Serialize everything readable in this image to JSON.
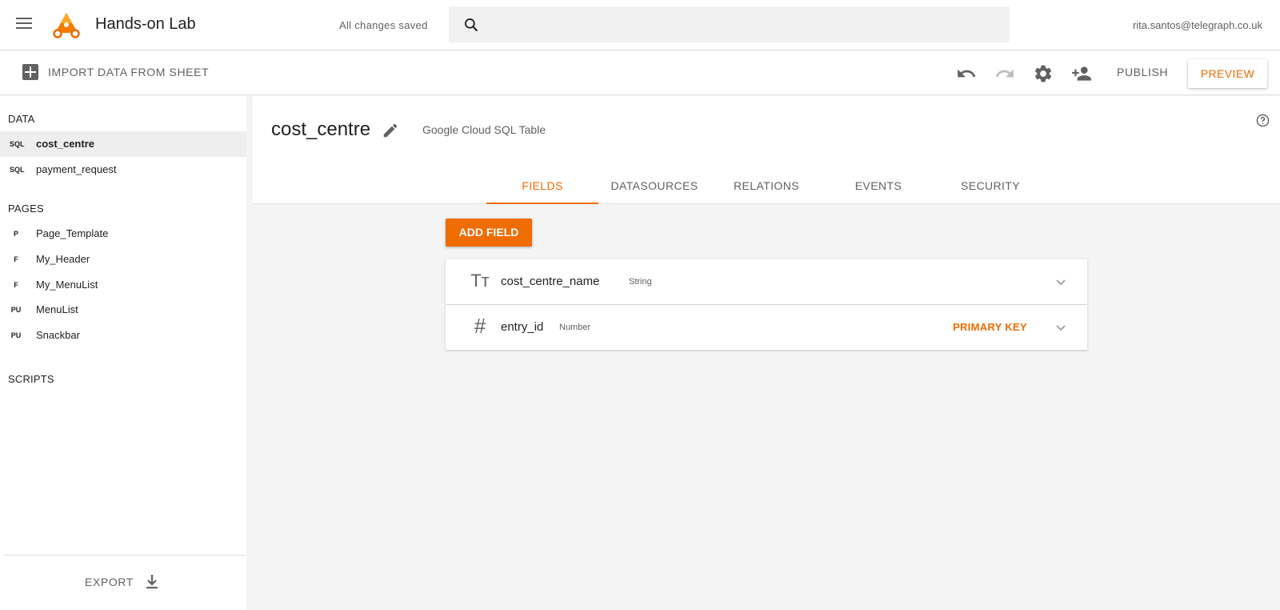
{
  "app": {
    "title": "Hands-on Lab",
    "save_status": "All changes saved",
    "user_email": "rita.santos@telegraph.co.uk",
    "accent": "#ef6c00"
  },
  "search": {
    "placeholder": "",
    "value": ""
  },
  "toolbar": {
    "import_label": "IMPORT DATA FROM SHEET",
    "publish_label": "PUBLISH",
    "preview_label": "PREVIEW",
    "icons": [
      "undo-icon",
      "redo-icon",
      "settings-icon",
      "add-person-icon"
    ]
  },
  "sidebar": {
    "data_heading": "DATA",
    "data_items": [
      {
        "badge": "SQL",
        "label": "cost_centre"
      },
      {
        "badge": "SQL",
        "label": "payment_request"
      }
    ],
    "pages_heading": "PAGES",
    "page_items": [
      {
        "badge": "P",
        "label": "Page_Template"
      },
      {
        "badge": "F",
        "label": "My_Header"
      },
      {
        "badge": "F",
        "label": "My_MenuList"
      },
      {
        "badge": "PU",
        "label": "MenuList"
      },
      {
        "badge": "PU",
        "label": "Snackbar"
      }
    ],
    "scripts_heading": "SCRIPTS",
    "export_label": "EXPORT"
  },
  "model": {
    "name": "cost_centre",
    "type": "Google Cloud SQL Table",
    "tabs": [
      "FIELDS",
      "DATASOURCES",
      "RELATIONS",
      "EVENTS",
      "SECURITY"
    ],
    "active_tab": "FIELDS",
    "add_field_label": "ADD FIELD",
    "fields": [
      {
        "icon": "Tт",
        "name": "cost_centre_name",
        "type": "String",
        "badge": ""
      },
      {
        "icon": "#",
        "name": "entry_id",
        "type": "Number",
        "badge": "PRIMARY KEY"
      }
    ]
  }
}
